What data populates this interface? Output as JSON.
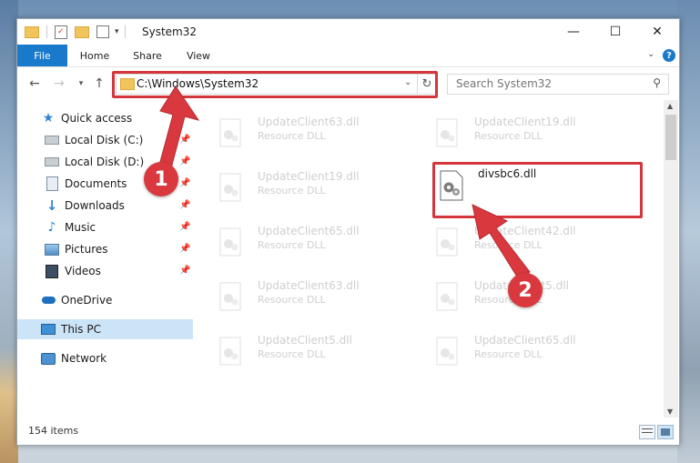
{
  "window": {
    "title": "System32",
    "controls": {
      "minimize": "—",
      "maximize": "☐",
      "close": "✕"
    }
  },
  "ribbon": {
    "tabs": [
      "File",
      "Home",
      "Share",
      "View"
    ],
    "expand_icon": "chevron-down-icon",
    "help_icon": "help-icon"
  },
  "nav": {
    "address": "C:\\Windows\\System32",
    "search_placeholder": "Search System32"
  },
  "sidebar": {
    "items": [
      {
        "label": "Quick access",
        "icon": "star-icon",
        "pinned": false
      },
      {
        "label": "Local Disk (C:)",
        "icon": "drive-icon",
        "pinned": true
      },
      {
        "label": "Local Disk (D:)",
        "icon": "drive-icon",
        "pinned": true
      },
      {
        "label": "Documents",
        "icon": "documents-icon",
        "pinned": true
      },
      {
        "label": "Downloads",
        "icon": "downloads-icon",
        "pinned": true
      },
      {
        "label": "Music",
        "icon": "music-icon",
        "pinned": true
      },
      {
        "label": "Pictures",
        "icon": "pictures-icon",
        "pinned": true
      },
      {
        "label": "Videos",
        "icon": "videos-icon",
        "pinned": true
      },
      {
        "label": "OneDrive",
        "icon": "cloud-icon",
        "pinned": false
      },
      {
        "label": "This PC",
        "icon": "computer-icon",
        "pinned": false,
        "selected": true
      },
      {
        "label": "Network",
        "icon": "network-icon",
        "pinned": false
      }
    ]
  },
  "files": {
    "left": [
      {
        "name": "UpdateClient63.dll",
        "type": "Resource DLL"
      },
      {
        "name": "UpdateClient19.dll",
        "type": "Resource DLL"
      },
      {
        "name": "UpdateClient65.dll",
        "type": "Resource DLL"
      },
      {
        "name": "UpdateClient63.dll",
        "type": "Resource DLL"
      },
      {
        "name": "UpdateClient5.dll",
        "type": "Resource DLL"
      }
    ],
    "right": [
      {
        "name": "UpdateClient19.dll",
        "type": "Resource DLL"
      },
      {
        "name": "divsbc6.dll",
        "type": "",
        "focus": true
      },
      {
        "name": "UpdateClient42.dll",
        "type": "Resource DLL"
      },
      {
        "name": "UpdateClient5.dll",
        "type": "Resource DLL"
      },
      {
        "name": "UpdateClient65.dll",
        "type": "Resource DLL"
      }
    ]
  },
  "annotations": {
    "step1": "1",
    "step2": "2",
    "color": "#d4363b"
  },
  "status": {
    "items_count": "154 items"
  }
}
